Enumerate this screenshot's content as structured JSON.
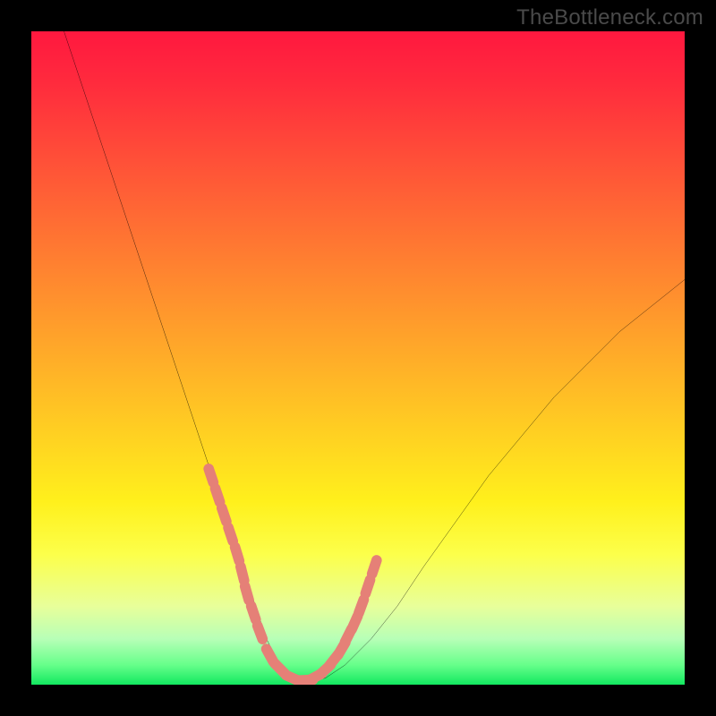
{
  "watermark": "TheBottleneck.com",
  "colors": {
    "curve": "#000000",
    "markers": "#e58077",
    "frame_bg": "#000000",
    "gradient_top": "#ff183f",
    "gradient_bottom": "#12e860"
  },
  "chart_data": {
    "type": "line",
    "title": "",
    "xlabel": "",
    "ylabel": "",
    "xlim": [
      0,
      100
    ],
    "ylim": [
      0,
      100
    ],
    "grid": false,
    "legend": false,
    "series": [
      {
        "name": "bottleneck-curve",
        "x": [
          5,
          8,
          11,
          14,
          17,
          20,
          23,
          25,
          27,
          29,
          31,
          32,
          33,
          34,
          35,
          36,
          37,
          38,
          40,
          42,
          45,
          48,
          52,
          56,
          60,
          65,
          70,
          75,
          80,
          85,
          90,
          95,
          100
        ],
        "y": [
          100,
          91,
          82,
          73,
          64,
          55,
          46,
          40,
          34,
          28,
          22,
          19,
          16,
          13,
          10,
          7,
          5,
          3,
          1,
          0.5,
          1,
          3,
          7,
          12,
          18,
          25,
          32,
          38,
          44,
          49,
          54,
          58,
          62
        ]
      }
    ],
    "markers": {
      "name": "highlighted-points",
      "x": [
        27.5,
        28.5,
        29.5,
        30.5,
        31.5,
        32.3,
        33.0,
        34.0,
        35.0,
        36.5,
        38.0,
        40.0,
        42.0,
        43.5,
        45.0,
        46.3,
        47.5,
        48.5,
        49.5,
        50.5,
        51.5,
        52.5
      ],
      "y": [
        32,
        29,
        26,
        23,
        20,
        17,
        14,
        11,
        8,
        4.5,
        2.5,
        1.0,
        0.7,
        1.2,
        2.3,
        3.8,
        5.5,
        7.5,
        9.5,
        12,
        15,
        18
      ]
    }
  }
}
